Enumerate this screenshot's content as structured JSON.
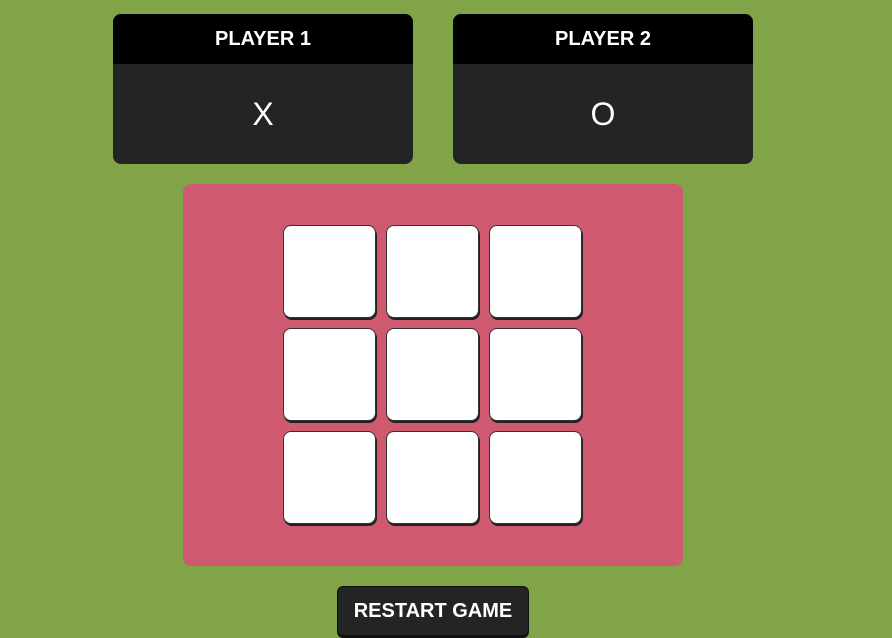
{
  "players": [
    {
      "label": "PLAYER 1",
      "mark": "X"
    },
    {
      "label": "PLAYER 2",
      "mark": "O"
    }
  ],
  "board": {
    "cells": [
      "",
      "",
      "",
      "",
      "",
      "",
      "",
      "",
      ""
    ]
  },
  "restart_label": "RESTART GAME",
  "colors": {
    "background": "#80a447",
    "board_panel": "#cf5a70",
    "card_header": "#000000",
    "card_body": "#242424",
    "cell": "#ffffff"
  }
}
